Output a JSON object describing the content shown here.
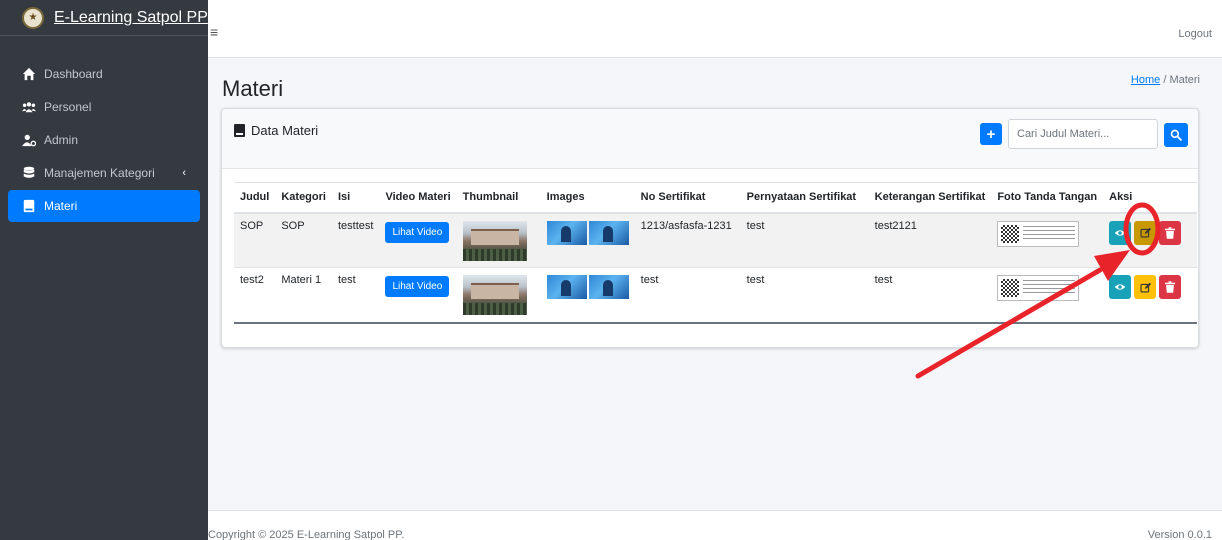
{
  "brand": {
    "title": "E-Learning Satpol PP",
    "logo": "logo-emblem"
  },
  "sidebar": {
    "items": [
      {
        "label": "Dashboard",
        "icon": "home-icon"
      },
      {
        "label": "Personel",
        "icon": "users-icon"
      },
      {
        "label": "Admin",
        "icon": "user-gear-icon"
      },
      {
        "label": "Manajemen Kategori",
        "icon": "database-icon",
        "chevron": "‹"
      },
      {
        "label": "Materi",
        "icon": "book-icon",
        "active": true
      }
    ]
  },
  "topbar": {
    "menu_glyph": "≡",
    "logout": "Logout"
  },
  "page": {
    "title": "Materi"
  },
  "breadcrumb": {
    "home": "Home",
    "separator": "/",
    "current": "Materi"
  },
  "card": {
    "title": "Data Materi",
    "add_glyph": "+",
    "search_placeholder": "Cari Judul Materi..."
  },
  "table": {
    "headers": [
      "Judul",
      "Kategori",
      "Isi",
      "Video Materi",
      "Thumbnail",
      "Images",
      "No Sertifikat",
      "Pernyataan Sertifikat",
      "Keterangan Sertifikat",
      "Foto Tanda Tangan",
      "Aksi"
    ],
    "rows": [
      {
        "judul": "SOP",
        "kategori": "SOP",
        "isi": "testtest",
        "video_label": "Lihat Video",
        "no_sertifikat": "1213/asfasfa-1231",
        "pernyataan": "test",
        "keterangan": "test2121"
      },
      {
        "judul": "test2",
        "kategori": "Materi 1",
        "isi": "test",
        "video_label": "Lihat Video",
        "no_sertifikat": "test",
        "pernyataan": "test",
        "keterangan": "test"
      }
    ]
  },
  "footer": {
    "copyright": "Copyright © 2025 E-Learning Satpol PP.",
    "version": "Version 0.0.1"
  },
  "colors": {
    "sidebar_bg": "#343a40",
    "primary": "#007bff",
    "info": "#17a2b8",
    "warning": "#ffc107",
    "danger": "#dc3545",
    "annotation": "#e8232a"
  }
}
